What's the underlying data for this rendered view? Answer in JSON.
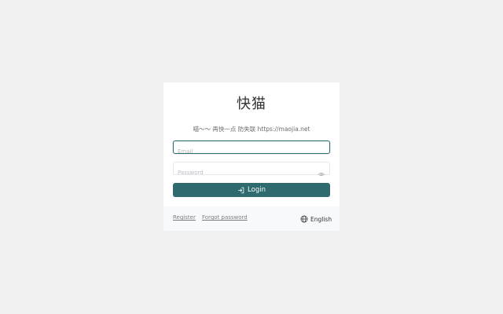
{
  "app": {
    "title": "快猫",
    "subtitle": "喵～～ 再快一点 防失联 https://maojia.net"
  },
  "form": {
    "email_placeholder": "Email",
    "password_placeholder": "Password",
    "login_label": "Login"
  },
  "footer": {
    "register_label": "Register",
    "forgot_label": "Forgot password",
    "language_label": "English"
  },
  "icons": {
    "login": "login-icon",
    "eye": "eye-icon",
    "globe": "globe-icon"
  },
  "colors": {
    "accent": "#2f6a6f",
    "background": "#f1f1f2"
  }
}
